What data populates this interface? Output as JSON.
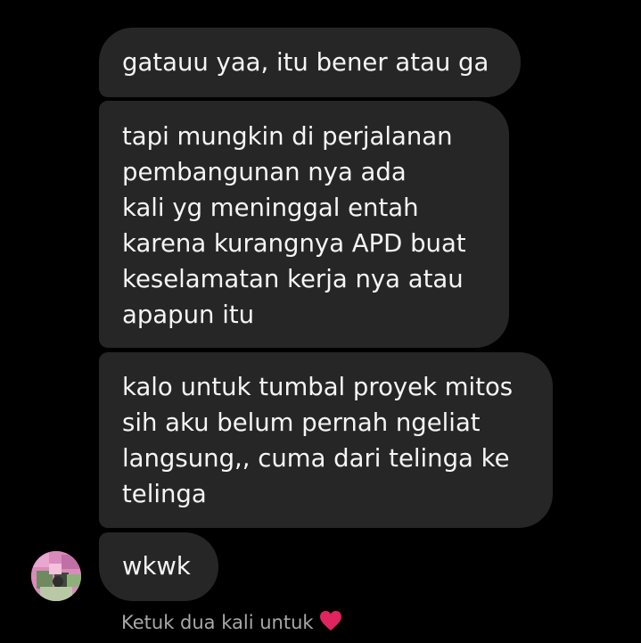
{
  "thread": {
    "messages": [
      {
        "lines": [
          "gatauu yaa, itu bener atau ga"
        ]
      },
      {
        "lines": [
          "tapi mungkin di perjalanan",
          "pembangunan nya ada",
          "kali yg meninggal entah",
          "karena kurangnya APD buat",
          "keselamatan kerja nya atau",
          "apapun itu"
        ]
      },
      {
        "lines": [
          "kalo untuk tumbal proyek mitos",
          "sih aku belum pernah ngeliat",
          "langsung,, cuma dari telinga ke",
          "telinga"
        ]
      },
      {
        "lines": [
          "wkwk"
        ]
      }
    ],
    "double_tap_hint": "Ketuk dua kali untuk",
    "hint_icon": "heart-icon"
  },
  "colors": {
    "background": "#000000",
    "bubble": "#262626",
    "text": "#f5f5f5",
    "hint_text": "#a8a8a8",
    "heart": "#e0245e"
  }
}
